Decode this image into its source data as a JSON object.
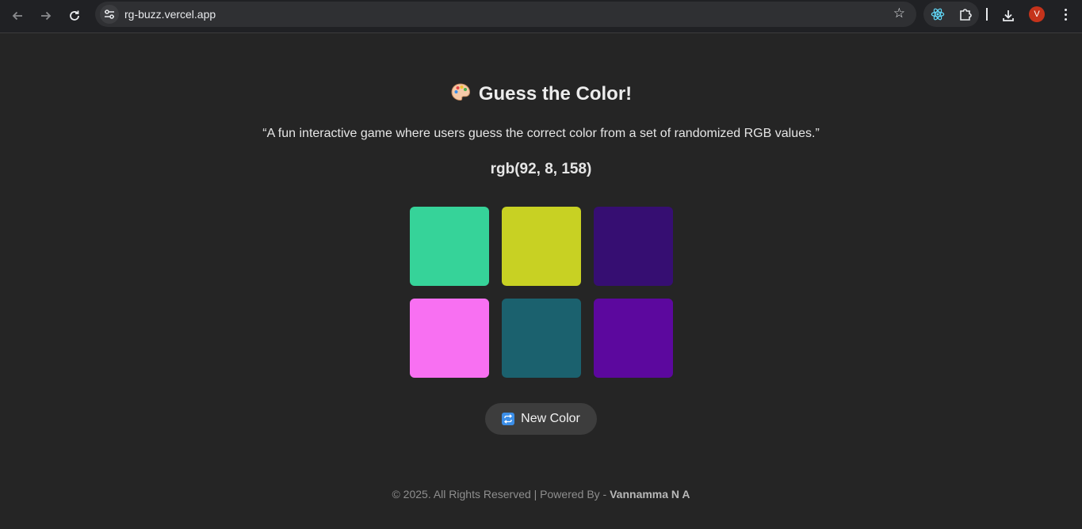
{
  "browser": {
    "url": "rg-buzz.vercel.app",
    "avatar_initial": "V"
  },
  "game": {
    "title": "Guess the Color!",
    "title_icon": "palette-icon",
    "description": "“A fun interactive game where users guess the correct color from a set of randomized RGB values.”",
    "target_rgb": "rgb(92, 8, 158)",
    "swatches": [
      {
        "color": "#36d399"
      },
      {
        "color": "#c8d123"
      },
      {
        "color": "#360e72"
      },
      {
        "color": "#f870f2"
      },
      {
        "color": "#1b616e"
      },
      {
        "color": "#5c089e"
      }
    ],
    "new_color_label": "New Color",
    "new_color_icon": "repeat-icon"
  },
  "footer": {
    "text": "© 2025. All Rights Reserved | Powered By - ",
    "author": "Vannamma N A"
  }
}
